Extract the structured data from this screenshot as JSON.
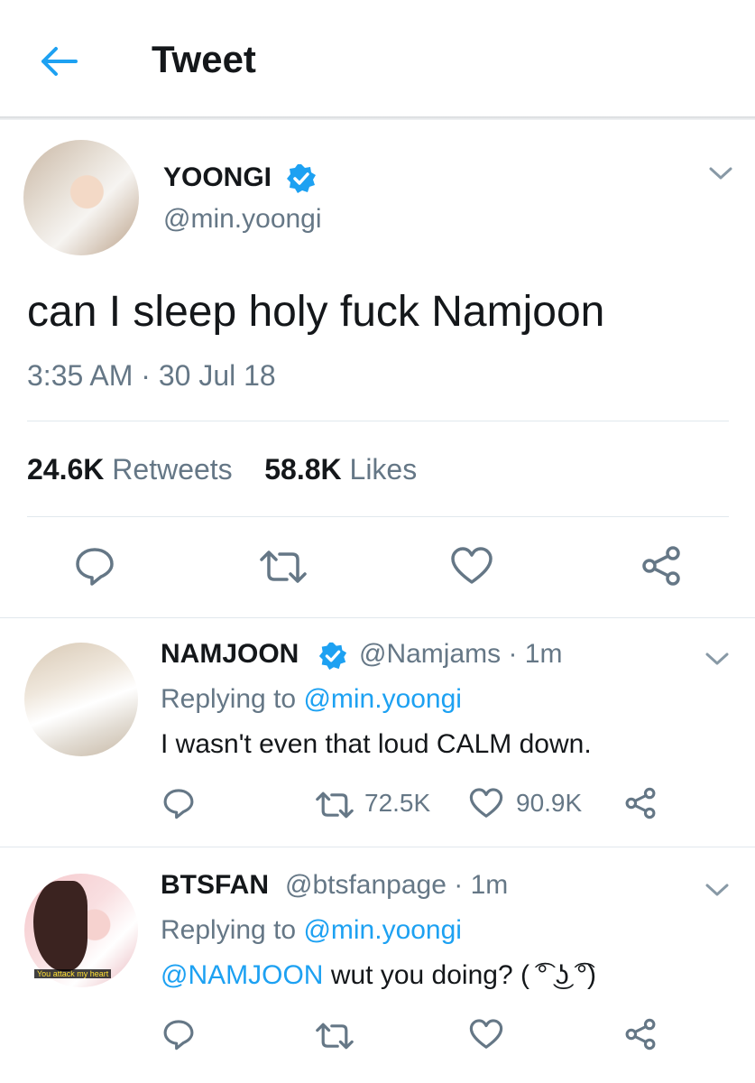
{
  "header": {
    "title": "Tweet",
    "back_icon": "arrow-left-icon",
    "accent": "#1da1f2"
  },
  "main_tweet": {
    "author_name": "YOONGI",
    "verified": true,
    "handle": "@min.yoongi",
    "text": "can I sleep holy fuck Namjoon",
    "timestamp": "3:35 AM · 30 Jul 18",
    "retweets_count": "24.6K",
    "retweets_label": "Retweets",
    "likes_count": "58.8K",
    "likes_label": "Likes",
    "actions": [
      "reply-icon",
      "retweet-icon",
      "like-icon",
      "share-icon"
    ]
  },
  "replies": [
    {
      "author_name": "NAMJOON",
      "verified": true,
      "handle": "@Namjams",
      "time": "· 1m",
      "replying_label": "Replying to",
      "replying_to": "@min.yoongi",
      "text": "I wasn't even that loud CALM down.",
      "retweets": "72.5K",
      "likes": "90.9K"
    },
    {
      "author_name": "BTSFAN",
      "verified": false,
      "handle": "@btsfanpage",
      "time": "· 1m",
      "replying_label": "Replying to",
      "replying_to": "@min.yoongi",
      "mention": "@NAMJOON",
      "text": "wut you doing? ( ͡° ͜ʖ ͡°)",
      "avatar_caption": "You attack my heart"
    }
  ],
  "colors": {
    "text": "#14171a",
    "secondary": "#657786",
    "link": "#1da1f2",
    "divider": "#e1e8ed"
  }
}
